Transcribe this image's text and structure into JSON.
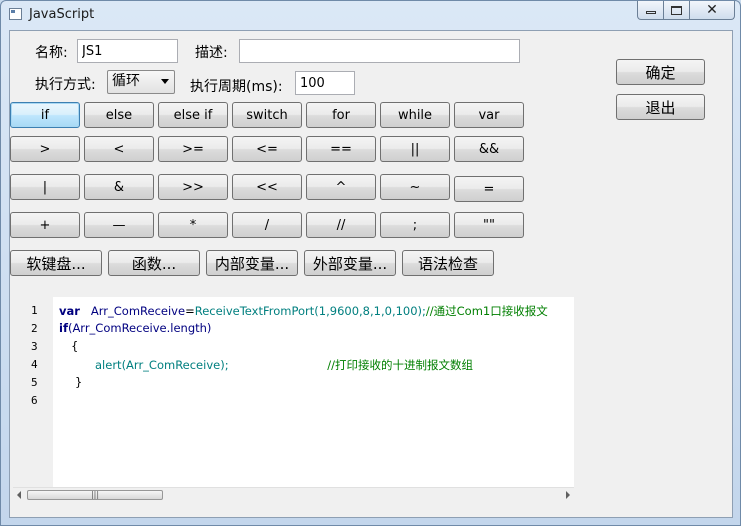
{
  "window": {
    "title": "JavaScript",
    "min_glyph": "",
    "max_glyph": "",
    "close_glyph": "✕"
  },
  "form": {
    "name_label": "名称:",
    "name_value": "JS1",
    "desc_label": "描述:",
    "desc_value": "",
    "mode_label": "执行方式:",
    "mode_value": "循环",
    "period_label": "执行周期(ms):",
    "period_value": "100"
  },
  "actions": {
    "ok": "确定",
    "exit": "退出"
  },
  "keyword_rows": [
    [
      "if",
      "else",
      "else if",
      "switch",
      "for",
      "while",
      "var"
    ],
    [
      ">",
      "<",
      ">=",
      "<=",
      "==",
      "||",
      "&&"
    ],
    [
      "|",
      "&",
      ">>",
      "<<",
      "^",
      "~",
      "="
    ],
    [
      "+",
      "—",
      "*",
      "/",
      "//",
      ";",
      "\"\""
    ]
  ],
  "tool_buttons": [
    "软键盘...",
    "函数...",
    "内部变量...",
    "外部变量...",
    "语法检查"
  ],
  "editor": {
    "line_numbers": [
      "1",
      "2",
      "3",
      "4",
      "5",
      "6"
    ],
    "line1": {
      "kw": "var",
      "id": "Arr_ComReceive",
      "eq": "=",
      "fn": "ReceiveTextFromPort",
      "args": "(1,9600,8,1,0,100);",
      "comment": "//通过Com1口接收报文"
    },
    "line2": {
      "kw": "if",
      "rest": "(Arr_ComReceive.length)"
    },
    "line3": {
      "brace": "{"
    },
    "line4": {
      "fn": "alert",
      "rest": "(Arr_ComReceive);",
      "comment": "//打印接收的十进制报文数组"
    },
    "line5": {
      "brace": "}"
    },
    "scroll_grip": "|||"
  }
}
